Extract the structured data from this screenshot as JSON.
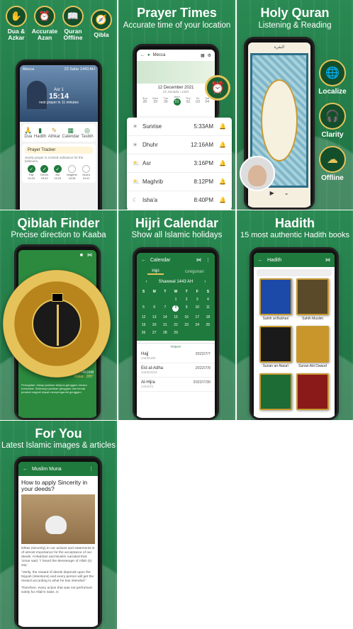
{
  "home": {
    "features": [
      {
        "label": "Dua &\nAzkar"
      },
      {
        "label": "Accurate\nAzan"
      },
      {
        "label": "Quran\nOffline"
      },
      {
        "label": "Qibla"
      }
    ],
    "location": "Mecca",
    "date": "23 Safar 1443 AH",
    "next_prayer": "Asr 1",
    "time": "15:14",
    "countdown": "next prayer in 11 minutes",
    "menu": [
      "Dua",
      "Hadith",
      "Athkar",
      "Calendar",
      "Tasbih"
    ],
    "tracker_title": "Prayer Tracker",
    "tracker_text": "Surely prayer is a timed ordinance for the believers.",
    "tracker_days": [
      "Fajr\n04:23",
      "Dhuhr\n15:42",
      "Asr\n15:20",
      "Maghrib\n18:35",
      "Isha'a\n19:41"
    ]
  },
  "prayer": {
    "title": "Prayer Times",
    "subtitle": "Accurate time of your location",
    "location": "Mecca",
    "date": "12 December 2021",
    "hijri": "22 Jumada I 1443",
    "week_labels": [
      "Sun",
      "Mon",
      "Tue",
      "Wed",
      "Thu",
      "Fri",
      "Sat"
    ],
    "week_days": [
      "28",
      "29",
      "30",
      "01",
      "02",
      "03",
      "04"
    ],
    "times": [
      {
        "name": "Sunrise",
        "time": "5:33AM"
      },
      {
        "name": "Dhuhr",
        "time": "12:16AM"
      },
      {
        "name": "Asr",
        "time": "3:16PM"
      },
      {
        "name": "Maghrib",
        "time": "8:12PM"
      },
      {
        "name": "Isha'a",
        "time": "8:40PM"
      }
    ]
  },
  "quran": {
    "title": "Holy Quran",
    "subtitle": "Listening & Reading",
    "surah": "البقرة",
    "badges": [
      "Localize",
      "Clarity",
      "Offline"
    ]
  },
  "qibla": {
    "title": "Qiblah Finder",
    "subtitle": "Precise direction to Kaaba",
    "distance": "Jarak dari Ka'bah : 7491KM",
    "kiblat": "Kiblat : 285°",
    "note": "Peringatan: Harap jauhkan telepon genggam secara horizontal. Sekiranya jauhkan genggam dari benda perabot magnet dapat mempengaruhi genggam"
  },
  "calendar": {
    "title": "Hijri Calendar",
    "subtitle": "Show all Islamic holidays",
    "bar": "Calendar",
    "tab_hijri": "Hijri",
    "tab_greg": "Gregorian",
    "month": "Shawwal 1443 AH",
    "dow": [
      "S",
      "M",
      "T",
      "W",
      "T",
      "F",
      "S"
    ],
    "days": [
      "",
      "",
      "",
      "1",
      "2",
      "3",
      "4",
      "5",
      "6",
      "7",
      "8",
      "9",
      "10",
      "11",
      "12",
      "13",
      "14",
      "15",
      "16",
      "17",
      "18",
      "19",
      "20",
      "21",
      "22",
      "23",
      "24",
      "25",
      "26",
      "27",
      "28",
      "29"
    ],
    "selected": "8",
    "today": "TODAY",
    "events": [
      {
        "name": "Hajj",
        "hijri": "1443/12/8",
        "date": "2022/7/7"
      },
      {
        "name": "Eid al-Adha",
        "hijri": "1443/12/10",
        "date": "2022/7/9"
      },
      {
        "name": "Al-Hijra",
        "hijri": "1444/1/1",
        "date": "2022/7/30"
      }
    ]
  },
  "hadith": {
    "title": "Hadith",
    "subtitle": "15 most authentic Hadith books",
    "bar": "Hadith",
    "books": [
      {
        "name": "Sahih al-Bukhari",
        "color": "#1c4aa8"
      },
      {
        "name": "Sahih Muslim",
        "color": "#5a4a2a"
      },
      {
        "name": "Sunan an-Nasa'i",
        "color": "#1a1a1a"
      },
      {
        "name": "Sunan Abi Dawud",
        "color": "#c8962a"
      },
      {
        "name": "",
        "color": "#1d6b35"
      },
      {
        "name": "",
        "color": "#8a1a1a"
      }
    ]
  },
  "foryou": {
    "title": "For You",
    "subtitle": "Latest Islamic images & articles",
    "bar": "Muslim Muna",
    "heading": "How to apply Sincerity in your deeds?",
    "p1": "Ikhlas (sincerity) in our actions and statements is of utmost importance for the acceptance of our deeds. Al-Bukhari and Muslim narrated that: 'Umar said, \"I heard the Messenger of Allah (s) say:",
    "p2": "\"Verily, the reward of deeds depends upon the Niyyah (intentions) and every person will get the reward according to what he has intended.\"",
    "p3": "Therefore, every action that was not performed solely for Allah's Sake, is"
  }
}
